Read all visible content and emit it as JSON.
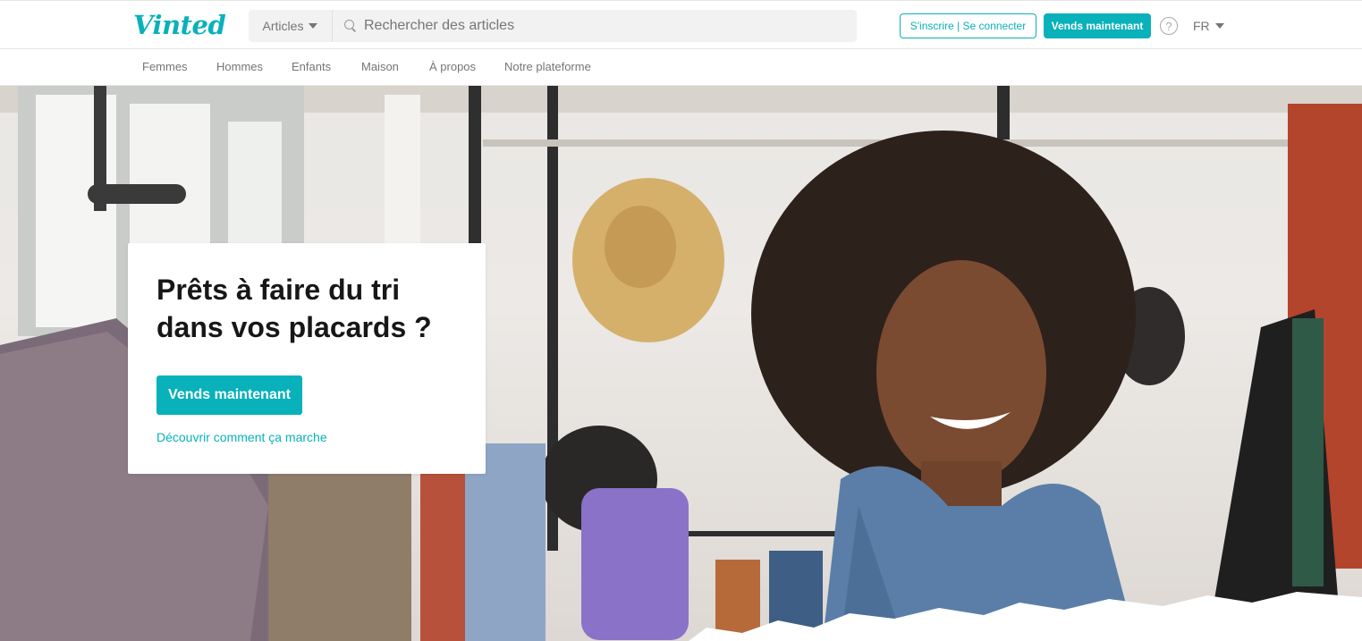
{
  "brand": {
    "logo_text": "Vinted",
    "accent_color": "#09b1ba"
  },
  "header": {
    "catalog_select": "Articles",
    "search_placeholder": "Rechercher des articles",
    "auth_button": "S'inscrire | Se connecter",
    "sell_button": "Vends maintenant",
    "help_icon": "question-circle-icon",
    "language": "FR"
  },
  "subnav": {
    "items": [
      "Femmes",
      "Hommes",
      "Enfants",
      "Maison",
      "À propos",
      "Notre plateforme"
    ]
  },
  "hero": {
    "title": "Prêts à faire du tri dans vos placards ?",
    "cta_button": "Vends maintenant",
    "link": "Découvrir comment ça marche"
  }
}
